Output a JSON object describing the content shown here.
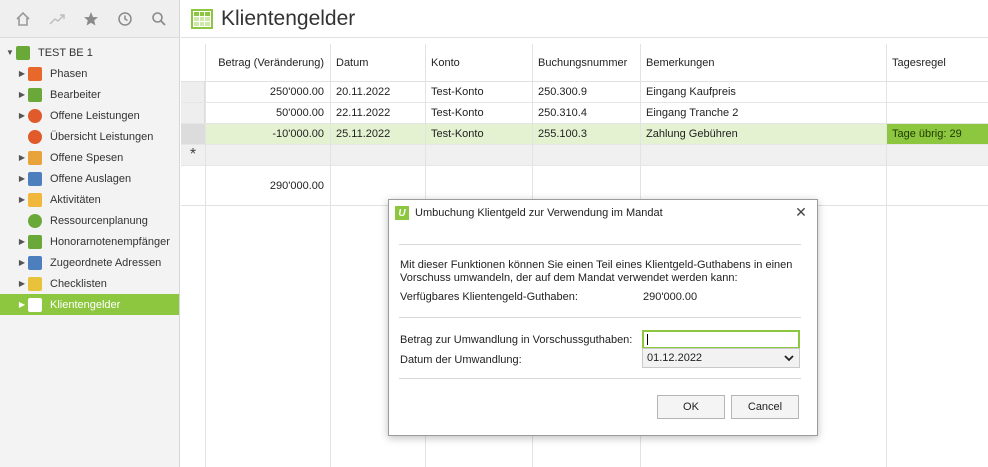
{
  "sidebar": {
    "root_label": "TEST BE 1",
    "items": [
      {
        "label": "Phasen",
        "icon": "phases-icon",
        "color": "#e8672b",
        "arrow": true
      },
      {
        "label": "Bearbeiter",
        "icon": "people-icon",
        "color": "#6aa83a",
        "arrow": true
      },
      {
        "label": "Offene Leistungen",
        "icon": "clock-icon",
        "color": "#e05a2b",
        "arrow": true
      },
      {
        "label": "Übersicht Leistungen",
        "icon": "chart-icon",
        "color": "#e05a2b",
        "arrow": false
      },
      {
        "label": "Offene Spesen",
        "icon": "receipt-icon",
        "color": "#e8a33a",
        "arrow": true
      },
      {
        "label": "Offene Auslagen",
        "icon": "document-icon",
        "color": "#4d7fbf",
        "arrow": true
      },
      {
        "label": "Aktivitäten",
        "icon": "activity-icon",
        "color": "#f0b73a",
        "arrow": true
      },
      {
        "label": "Ressourcenplanung",
        "icon": "pie-icon",
        "color": "#6aa83a",
        "arrow": false
      },
      {
        "label": "Honorarnotenempfänger",
        "icon": "building-icon",
        "color": "#6aa83a",
        "arrow": true
      },
      {
        "label": "Zugeordnete Adressen",
        "icon": "address-icon",
        "color": "#4d7fbf",
        "arrow": true
      },
      {
        "label": "Checklisten",
        "icon": "checklist-icon",
        "color": "#e8c23a",
        "arrow": true
      },
      {
        "label": "Klientengelder",
        "icon": "grid-icon",
        "color": "#ffffff",
        "arrow": true,
        "selected": true
      }
    ]
  },
  "main": {
    "title": "Klientengelder"
  },
  "table": {
    "columns": [
      "Betrag (Veränderung)",
      "Datum",
      "Konto",
      "Buchungsnummer",
      "Bemerkungen",
      "Tagesregel"
    ],
    "rows": [
      {
        "amount": "250'000.00",
        "date": "20.11.2022",
        "account": "Test-Konto",
        "number": "250.300.9",
        "remark": "Eingang Kaufpreis",
        "rule": ""
      },
      {
        "amount": "50'000.00",
        "date": "22.11.2022",
        "account": "Test-Konto",
        "number": "250.310.4",
        "remark": "Eingang Tranche 2",
        "rule": ""
      },
      {
        "amount": "-10'000.00",
        "date": "25.11.2022",
        "account": "Test-Konto",
        "number": "255.100.3",
        "remark": "Zahlung Gebühren",
        "rule": "Tage übrig: 29"
      }
    ],
    "new_row_marker": "*",
    "total": "290'000.00"
  },
  "dialog": {
    "title": "Umbuchung Klientgeld zur Verwendung im Mandat",
    "logo_letter": "U",
    "close_label": "✕",
    "description_line1": "Mit dieser Funktionen können Sie einen Teil eines Klientgeld-Guthabens in einen",
    "description_line2": "Vorschuss umwandeln, der auf dem Mandat verwendet werden kann:",
    "balance_label": "Verfügbares Klientengeld-Guthaben:",
    "balance_value": "290'000.00",
    "amount_label": "Betrag zur Umwandlung in Vorschussguthaben:",
    "amount_value": "",
    "date_label": "Datum der Umwandlung:",
    "date_value": "01.12.2022",
    "ok_label": "OK",
    "cancel_label": "Cancel"
  },
  "colors": {
    "accent": "#8dc63f",
    "highlight_row": "#e4f2d2"
  }
}
